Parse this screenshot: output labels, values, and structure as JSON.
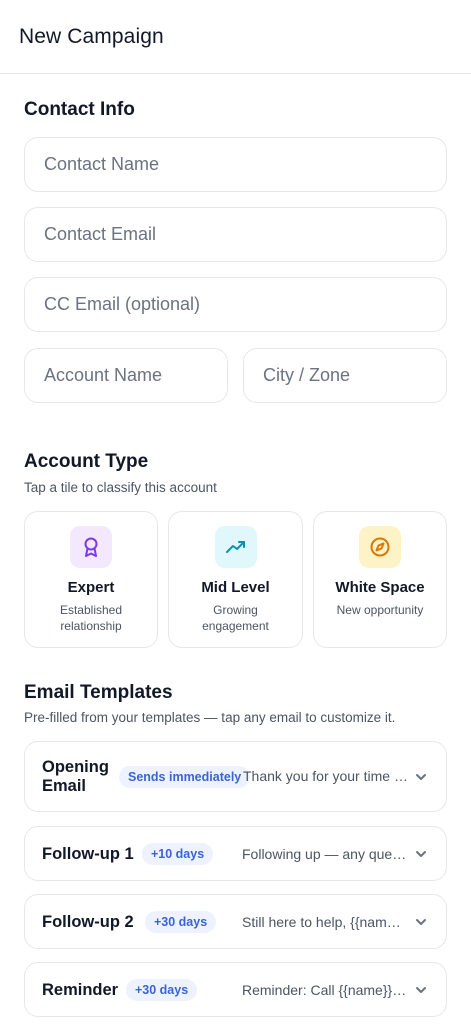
{
  "header": {
    "title": "New Campaign"
  },
  "contact_info": {
    "title": "Contact Info",
    "fields": {
      "contact_name": {
        "placeholder": "Contact Name"
      },
      "contact_email": {
        "placeholder": "Contact Email"
      },
      "cc_email": {
        "placeholder": "CC Email (optional)"
      },
      "account_name": {
        "placeholder": "Account Name"
      },
      "city_zone": {
        "placeholder": "City / Zone"
      }
    }
  },
  "account_type": {
    "title": "Account Type",
    "subtitle": "Tap a tile to classify this account",
    "tiles": [
      {
        "label": "Expert",
        "description": "Established relationship",
        "icon": "award-icon",
        "color": "#7c3aed",
        "bg": "#f3e8ff"
      },
      {
        "label": "Mid Level",
        "description": "Growing engagement",
        "icon": "trending-up-icon",
        "color": "#0891b2",
        "bg": "#e0f7fb"
      },
      {
        "label": "White Space",
        "description": "New opportunity",
        "icon": "compass-icon",
        "color": "#d97706",
        "bg": "#fef3c7"
      }
    ]
  },
  "email_templates": {
    "title": "Email Templates",
    "subtitle": "Pre-filled from your templates — tap any email to customize it.",
    "items": [
      {
        "name": "Opening Email",
        "name_line1": "Opening",
        "name_line2": "Email",
        "badge": "Sends immediately",
        "preview": "Thank you for your time today..."
      },
      {
        "name": "Follow-up 1",
        "badge": "+10 days",
        "preview": "Following up — any questions..."
      },
      {
        "name": "Follow-up 2",
        "badge": "+30 days",
        "preview": "Still here to help, {{name}}..."
      },
      {
        "name": "Reminder",
        "badge": "+30 days",
        "preview": "Reminder: Call {{name}} this week..."
      }
    ]
  }
}
